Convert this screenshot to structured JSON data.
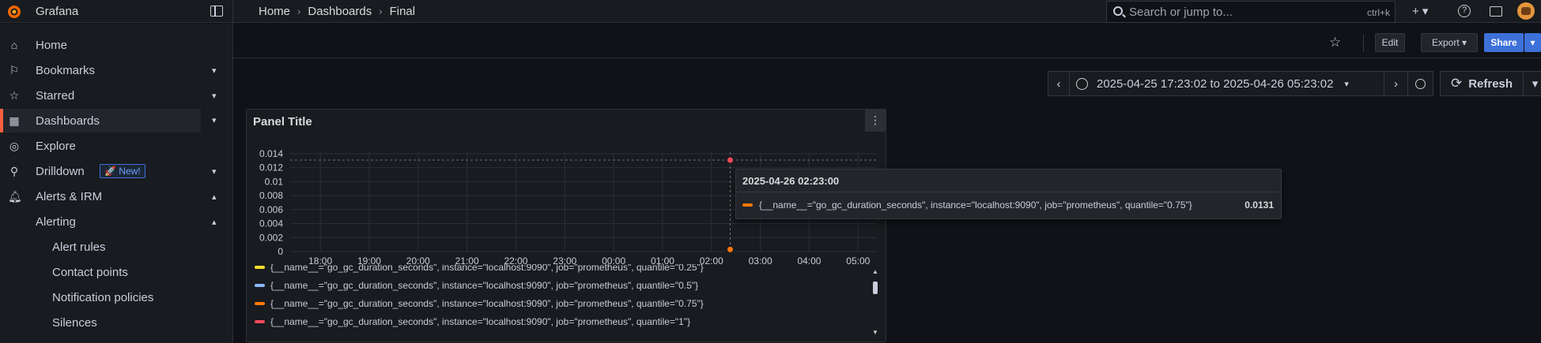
{
  "app": {
    "brand": "Grafana"
  },
  "breadcrumbs": [
    "Home",
    "Dashboards",
    "Final"
  ],
  "search": {
    "placeholder": "Search or jump to...",
    "shortcut": "ctrl+k"
  },
  "topbar_icons": [
    "plus-icon",
    "help-icon",
    "news-icon",
    "user-avatar"
  ],
  "sidebar": {
    "items": [
      {
        "label": "Home",
        "icon": "home-icon"
      },
      {
        "label": "Bookmarks",
        "icon": "bookmark-icon",
        "expand": "down"
      },
      {
        "label": "Starred",
        "icon": "star-icon",
        "expand": "down"
      },
      {
        "label": "Dashboards",
        "icon": "dashboards-icon",
        "expand": "down",
        "active": true
      },
      {
        "label": "Explore",
        "icon": "compass-icon"
      },
      {
        "label": "Drilldown",
        "icon": "drilldown-icon",
        "badge": "New!",
        "expand": "down"
      },
      {
        "label": "Alerts & IRM",
        "icon": "bell-icon",
        "expand": "up"
      },
      {
        "label": "Alerting",
        "expand": "up"
      },
      {
        "label": "Alert rules"
      },
      {
        "label": "Contact points"
      },
      {
        "label": "Notification policies"
      },
      {
        "label": "Silences"
      }
    ]
  },
  "toolbar": {
    "edit": "Edit",
    "export": "Export",
    "share": "Share"
  },
  "timepicker": {
    "range": "2025-04-25 17:23:02 to 2025-04-26 05:23:02",
    "refresh": "Refresh"
  },
  "panel": {
    "title": "Panel Title"
  },
  "chart_data": {
    "type": "line",
    "x_ticks": [
      "18:00",
      "19:00",
      "20:00",
      "21:00",
      "22:00",
      "23:00",
      "00:00",
      "01:00",
      "02:00",
      "03:00",
      "04:00",
      "05:00"
    ],
    "y_ticks": [
      "0.014",
      "0.012",
      "0.01",
      "0.008",
      "0.006",
      "0.004",
      "0.002",
      "0"
    ],
    "ylim": [
      0,
      0.014
    ],
    "grid": true,
    "series": [
      {
        "name": "{__name__=\"go_gc_duration_seconds\", instance=\"localhost:9090\", job=\"prometheus\", quantile=\"0.25\"}",
        "color": "#fade2a",
        "x": [
          "02:23"
        ],
        "values": [
          0.0001
        ]
      },
      {
        "name": "{__name__=\"go_gc_duration_seconds\", instance=\"localhost:9090\", job=\"prometheus\", quantile=\"0.5\"}",
        "color": "#8ab8ff",
        "x": [
          "02:23"
        ],
        "values": [
          0.0002
        ]
      },
      {
        "name": "{__name__=\"go_gc_duration_seconds\", instance=\"localhost:9090\", job=\"prometheus\", quantile=\"0.75\"}",
        "color": "#ff780a",
        "x": [
          "02:23"
        ],
        "values": [
          0.0003
        ]
      },
      {
        "name": "{__name__=\"go_gc_duration_seconds\", instance=\"localhost:9090\", job=\"prometheus\", quantile=\"1\"}",
        "color": "#f2495c",
        "x": [
          "02:23"
        ],
        "values": [
          0.0131
        ]
      }
    ]
  },
  "tooltip": {
    "time": "2025-04-26 02:23:00",
    "label": "{__name__=\"go_gc_duration_seconds\", instance=\"localhost:9090\", job=\"prometheus\", quantile=\"0.75\"}",
    "value": "0.0131"
  }
}
